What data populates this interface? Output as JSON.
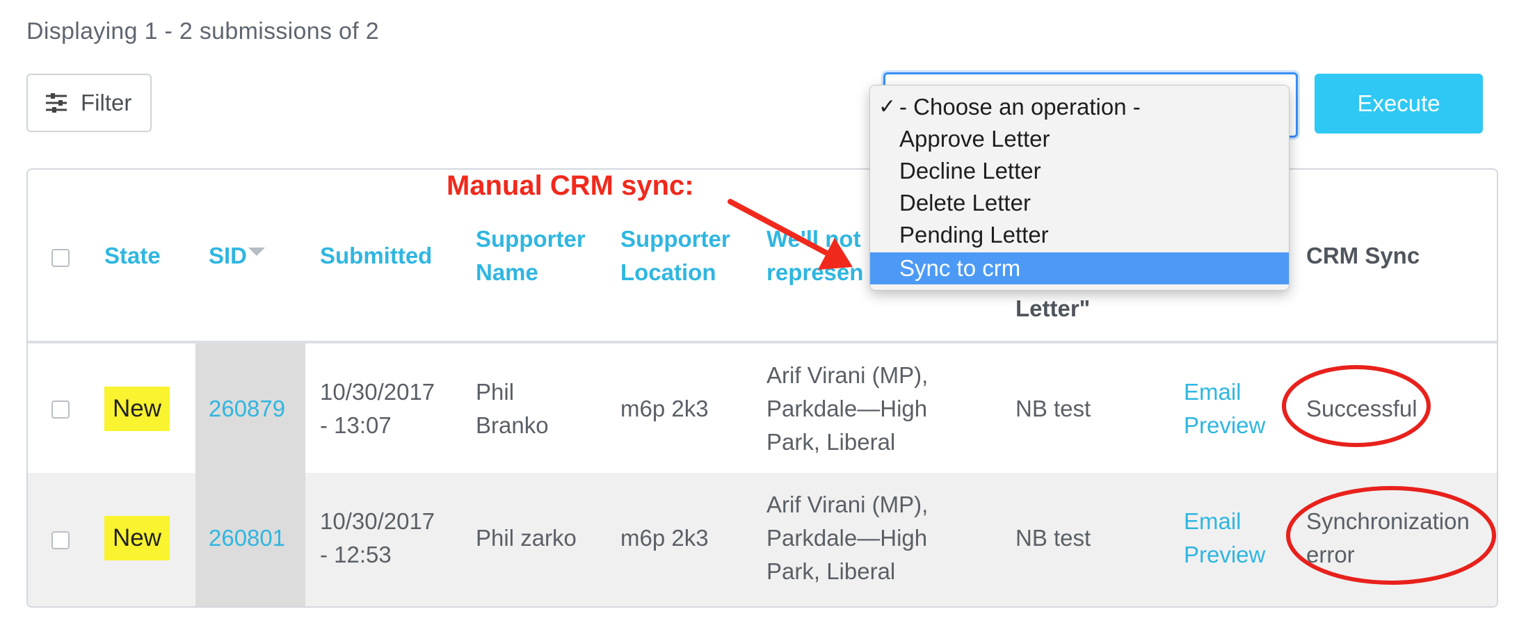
{
  "summary": "Displaying 1 - 2 submissions of 2",
  "filter": {
    "label": "Filter",
    "icon": "sliders-icon"
  },
  "operation": {
    "options": [
      {
        "label": "- Choose an operation -",
        "checked": true
      },
      {
        "label": "Approve Letter"
      },
      {
        "label": "Decline Letter"
      },
      {
        "label": "Delete Letter"
      },
      {
        "label": "Pending Letter"
      },
      {
        "label": "Sync to crm",
        "highlighted": true
      }
    ]
  },
  "execute": {
    "label": "Execute"
  },
  "annotation": {
    "text": "Manual CRM sync:"
  },
  "table": {
    "headers": {
      "state": "State",
      "sid": "SID",
      "submitted": "Submitted",
      "supporter_name": [
        "Supporter",
        "Name"
      ],
      "supporter_location": [
        "Supporter",
        "Location"
      ],
      "representative": [
        "We'll not",
        "represen"
      ],
      "letter": "Letter\"",
      "crm_sync": "CRM Sync"
    },
    "rows": [
      {
        "state": "New",
        "sid": "260879",
        "submitted": [
          "10/30/2017",
          "- 13:07"
        ],
        "supporter_name": [
          "Phil",
          "Branko"
        ],
        "location": "m6p 2k3",
        "representative": [
          "Arif Virani (MP),",
          "Parkdale—High",
          "Park, Liberal"
        ],
        "letter": "NB test",
        "preview": [
          "Email",
          "Preview"
        ],
        "crm_sync": [
          "Successful"
        ]
      },
      {
        "state": "New",
        "sid": "260801",
        "submitted": [
          "10/30/2017",
          "- 12:53"
        ],
        "supporter_name": [
          "Phil zarko"
        ],
        "location": "m6p 2k3",
        "representative": [
          "Arif Virani (MP),",
          "Parkdale—High",
          "Park, Liberal"
        ],
        "letter": "NB test",
        "preview": [
          "Email",
          "Preview"
        ],
        "crm_sync": [
          "Synchronization",
          "error"
        ]
      }
    ]
  },
  "colors": {
    "accent": "#2fc8f4",
    "link": "#2fb6e0",
    "badge": "#f9f330",
    "annotation": "#f0291c",
    "highlight": "#4c9af5"
  }
}
